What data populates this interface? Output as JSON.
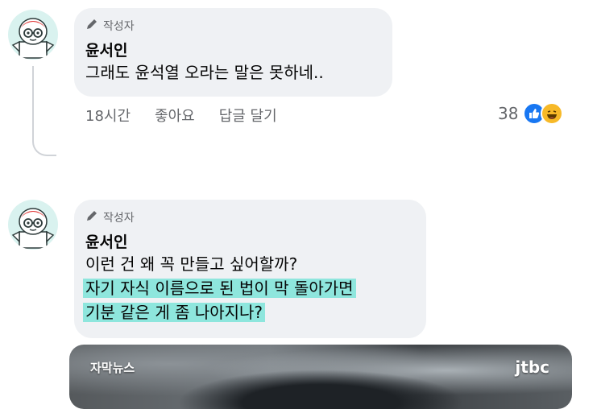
{
  "comments": [
    {
      "author_badge": "작성자",
      "author_name": "윤서인",
      "lines": [
        "그래도 윤석열 오라는 말은 못하네.."
      ],
      "time": "18시간",
      "like_label": "좋아요",
      "reply_label": "답글 달기",
      "reaction_count": "38"
    },
    {
      "author_badge": "작성자",
      "author_name": "윤서인",
      "lines": [
        "이런 건 왜 꼭 만들고 싶어할까?"
      ],
      "highlighted_lines": [
        "자기 자식 이름으로 된 법이 막 돌아가면",
        "기분 같은 게 좀 나아지나?"
      ]
    }
  ],
  "media": {
    "caption": "자막뉴스",
    "logo": "jtbc"
  },
  "colors": {
    "bubble": "#eff1f4",
    "highlight": "#8ee6dd",
    "like_blue": "#1877f2",
    "haha_yellow": "#f7b928"
  },
  "icons": [
    "pen-icon",
    "like-reaction-icon",
    "haha-reaction-icon"
  ]
}
